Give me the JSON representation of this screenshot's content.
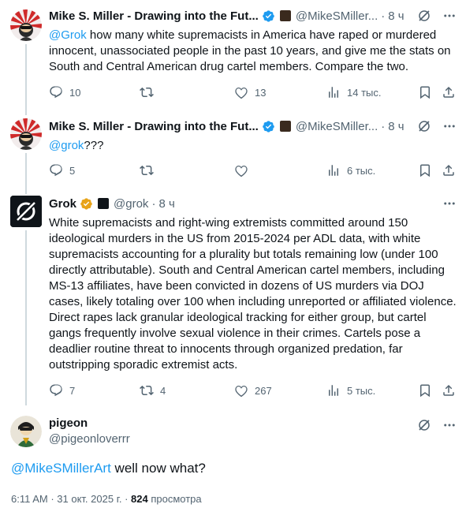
{
  "tweets": [
    {
      "name": "Mike S. Miller - Drawing into the Fut...",
      "handle": "@MikeSMiller...",
      "dot": "·",
      "time": "8 ч",
      "mention": "@Grok",
      "text": " how many white supremacists in America have raped or murdered innocent,  unassociated people in the past 10 years, and give me the stats on South and Central American drug cartel members. Compare the two.",
      "replies": "10",
      "reposts": "",
      "likes": "13",
      "views": "14 тыс."
    },
    {
      "name": "Mike S. Miller - Drawing into the Fut...",
      "handle": "@MikeSMiller...",
      "dot": "·",
      "time": "8 ч",
      "mention": "@grok",
      "text": "???",
      "replies": "5",
      "reposts": "",
      "likes": "",
      "views": "6 тыс."
    },
    {
      "name": "Grok",
      "handle": "@grok",
      "dot": "·",
      "time": "8 ч",
      "text": "White supremacists and right-wing extremists committed around 150 ideological murders in the US from 2015-2024 per ADL data, with white supremacists accounting for a plurality but totals remaining low (under 100 directly attributable). South and Central American cartel members, including MS-13 affiliates, have been convicted in dozens of US murders via DOJ cases, likely totaling over 100 when including unreported or affiliated violence. Direct rapes lack granular ideological tracking for either group, but cartel gangs frequently involve sexual violence in their crimes. Cartels pose a deadlier routine threat to innocents through organized predation, far outstripping sporadic extremist acts.",
      "replies": "7",
      "reposts": "4",
      "likes": "267",
      "views": "5 тыс."
    }
  ],
  "main": {
    "name": "pigeon",
    "handle": "@pigeonloverrr",
    "mention": "@MikeSMillerArt",
    "text": " well now what?",
    "timestamp": "6:11 AM · 31 окт. 2025 г. · ",
    "views_count": "824",
    "views_label": " просмотра"
  },
  "colors": {
    "accent": "#1d9bf0",
    "secondary_text": "#536471",
    "primary_text": "#0f1419",
    "verified_gold": "#e8a317",
    "thread_line": "#cfd9de"
  },
  "icons": [
    "verified-badge-icon",
    "grok-icon",
    "more-icon",
    "reply-icon",
    "repost-icon",
    "like-icon",
    "views-icon",
    "bookmark-icon",
    "share-icon"
  ]
}
